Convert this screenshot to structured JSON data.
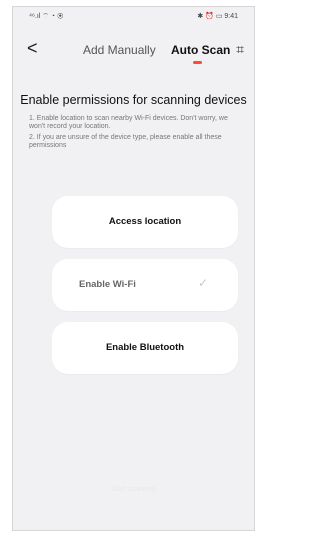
{
  "status_bar": {
    "left": "⁴⁶.ıl ⌔ ◔ ◉",
    "right": "✱ ⏰ ▭ 9:41"
  },
  "nav": {
    "back_label": "<",
    "tab_manual": "Add Manually",
    "tab_auto": "Auto Scan",
    "scan_icon": "⌗"
  },
  "main": {
    "heading": "Enable permissions for scanning devices",
    "notes": [
      "1. Enable location to scan nearby Wi-Fi devices. Don't worry, we won't record your location.",
      "2. If you are unsure of the device type, please enable all these permissions"
    ],
    "buttons": {
      "access_location": "Access location",
      "enable_wifi": "Enable Wi-Fi",
      "wifi_check": "✓",
      "enable_bluetooth": "Enable Bluetooth"
    },
    "start_label": "Start scanning"
  },
  "colors": {
    "accent": "#ff4b30",
    "background": "#f1f1f3",
    "card": "#ffffff"
  }
}
